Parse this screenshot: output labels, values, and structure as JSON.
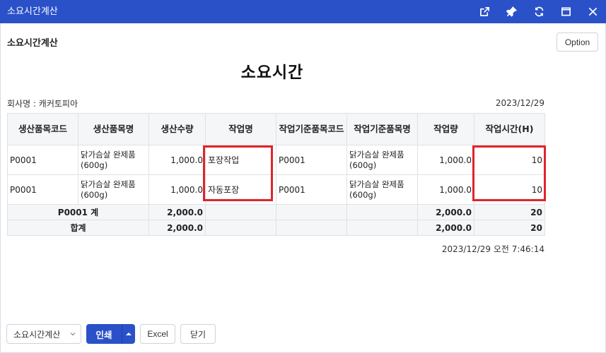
{
  "window": {
    "title": "소요시간계산",
    "controls": [
      "external-link-icon",
      "pin-icon",
      "refresh-icon",
      "maximize-icon",
      "close-icon"
    ]
  },
  "header": {
    "page_title": "소요시간계산",
    "option_label": "Option"
  },
  "report": {
    "title": "소요시간",
    "company": "회사명 : 캐커토피아",
    "date": "2023/12/29",
    "columns": [
      "생산품목코드",
      "생산품목명",
      "생산수량",
      "작업명",
      "작업기준품목코드",
      "작업기준품목명",
      "작업량",
      "작업시간(H)"
    ],
    "rows": [
      {
        "prod_code": "P0001",
        "prod_name": "닭가슴살 완제품(600g)",
        "prod_qty": "1,000.0",
        "job_name": "포장작업",
        "std_code": "P0001",
        "std_name": "닭가슴살 완제품(600g)",
        "work_qty": "1,000.0",
        "work_hours": "10"
      },
      {
        "prod_code": "P0001",
        "prod_name": "닭가슴살 완제품(600g)",
        "prod_qty": "1,000.0",
        "job_name": "자동포장",
        "std_code": "P0001",
        "std_name": "닭가슴살 완제품(600g)",
        "work_qty": "1,000.0",
        "work_hours": "10"
      }
    ],
    "subtotal": {
      "label": "P0001 계",
      "prod_qty": "2,000.0",
      "work_qty": "2,000.0",
      "work_hours": "20"
    },
    "total": {
      "label": "합계",
      "prod_qty": "2,000.0",
      "work_qty": "2,000.0",
      "work_hours": "20"
    },
    "printed_at": "2023/12/29 오전 7:46:14"
  },
  "footer": {
    "select_value": "소요시간계산",
    "print_label": "인쇄",
    "excel_label": "Excel",
    "close_label": "닫기"
  },
  "colors": {
    "titlebar": "#2b51c9",
    "highlight": "#e0242b",
    "header_bg": "#f5f6f8"
  }
}
